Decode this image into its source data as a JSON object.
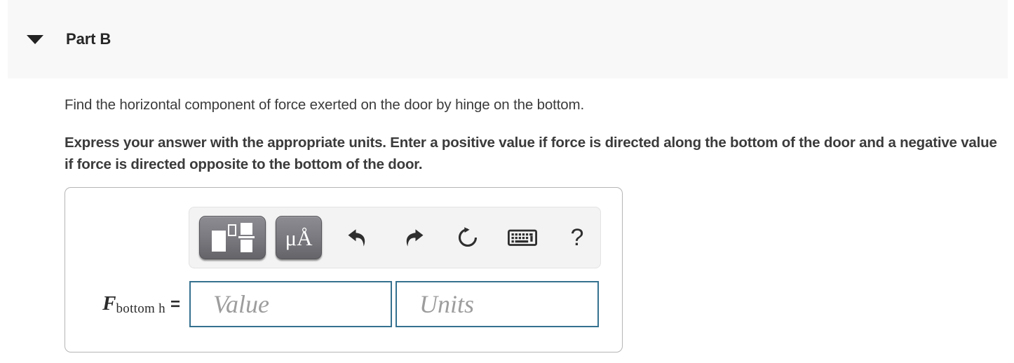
{
  "header": {
    "title": "Part B",
    "collapse_icon": "caret-down-icon"
  },
  "question": {
    "prompt": "Find the horizontal component of force exerted on the door by hinge on the bottom.",
    "instruction": "Express your answer with the appropriate units. Enter a positive value if force is directed along the bottom of the door and a negative value if force is directed opposite to the bottom of the door."
  },
  "toolbar": {
    "template_button": {
      "name": "math-template-icon",
      "tooltip": "Math templates"
    },
    "units_button": {
      "name": "units-icon",
      "label_mu": "μ",
      "label_angstrom": "Å"
    },
    "undo_button": {
      "name": "undo-icon"
    },
    "redo_button": {
      "name": "redo-icon"
    },
    "reset_button": {
      "name": "reset-icon"
    },
    "keyboard_button": {
      "name": "keyboard-icon"
    },
    "help_button": {
      "name": "help-icon",
      "label": "?"
    }
  },
  "answer": {
    "variable_symbol": "F",
    "variable_subscript": "bottom h",
    "equals": "=",
    "value_field": {
      "placeholder": "Value",
      "value": ""
    },
    "units_field": {
      "placeholder": "Units",
      "value": ""
    }
  },
  "colors": {
    "header_band": "#f8f8f8",
    "page_background": "#ffffff",
    "text": "#3b3b3b",
    "field_border": "#35718f",
    "panel_border": "#b5b5b5",
    "toolbar_background": "#f3f3f3",
    "button_dark": "#7c7c82"
  }
}
